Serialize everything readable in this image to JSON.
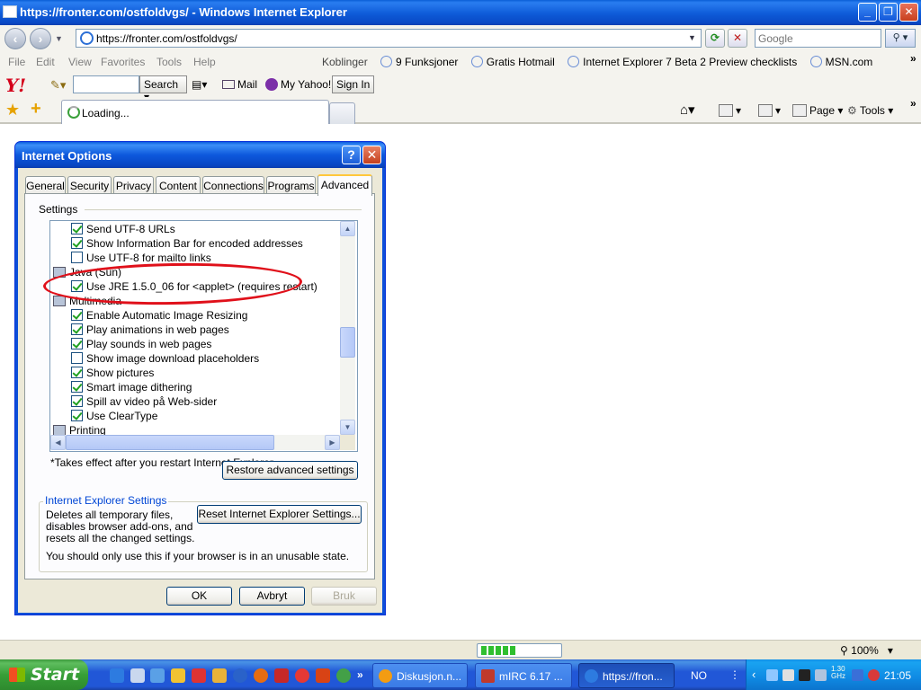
{
  "window": {
    "title": "https://fronter.com/ostfoldvgs/ - Windows Internet Explorer",
    "controls": {
      "minimize": "_",
      "maximize": "❐",
      "close": "✕"
    }
  },
  "address_bar": {
    "url": "https://fronter.com/ostfoldvgs/",
    "search_placeholder": "Google"
  },
  "menu": [
    "File",
    "Edit",
    "View",
    "Favorites",
    "Tools",
    "Help"
  ],
  "links_bar": {
    "label": "Koblinger",
    "links": [
      "9 Funksjoner",
      "Gratis Hotmail",
      "Internet Explorer 7 Beta 2 Preview checklists",
      "MSN.com"
    ]
  },
  "yahoo_toolbar": {
    "logo": "Y!",
    "search_button": "Search",
    "mail": "Mail",
    "my_yahoo": "My Yahoo!",
    "sign_in": "Sign In"
  },
  "tab_bar": {
    "active_tab": "Loading...",
    "page_menu": "Page",
    "tools_menu": "Tools"
  },
  "dialog": {
    "title": "Internet Options",
    "tabs": [
      "General",
      "Security",
      "Privacy",
      "Content",
      "Connections",
      "Programs",
      "Advanced"
    ],
    "active_tab": "Advanced",
    "settings_label": "Settings",
    "tree": [
      {
        "type": "check",
        "label": "Send UTF-8 URLs",
        "checked": true
      },
      {
        "type": "check",
        "label": "Show Information Bar for encoded addresses",
        "checked": true
      },
      {
        "type": "check",
        "label": "Use UTF-8 for mailto links",
        "checked": false
      },
      {
        "type": "category",
        "label": "Java (Sun)"
      },
      {
        "type": "check",
        "label": "Use JRE 1.5.0_06 for <applet> (requires restart)",
        "checked": true
      },
      {
        "type": "category",
        "label": "Multimedia"
      },
      {
        "type": "check",
        "label": "Enable Automatic Image Resizing",
        "checked": true
      },
      {
        "type": "check",
        "label": "Play animations in web pages",
        "checked": true
      },
      {
        "type": "check",
        "label": "Play sounds in web pages",
        "checked": true
      },
      {
        "type": "check",
        "label": "Show image download placeholders",
        "checked": false
      },
      {
        "type": "check",
        "label": "Show pictures",
        "checked": true
      },
      {
        "type": "check",
        "label": "Smart image dithering",
        "checked": true
      },
      {
        "type": "check",
        "label": "Spill av video på Web-sider",
        "checked": true
      },
      {
        "type": "check",
        "label": "Use ClearType",
        "checked": true
      },
      {
        "type": "category",
        "label": "Printing"
      }
    ],
    "restart_note": "*Takes effect after you restart Internet Explorer",
    "restore_button": "Restore advanced settings",
    "ie_settings": {
      "title": "Internet Explorer Settings",
      "description": "Deletes all temporary files, disables browser add-ons, and resets all the changed settings.",
      "reset_button": "Reset Internet Explorer Settings...",
      "warning": "You should only use this if your browser is in an unusable state."
    },
    "buttons": {
      "ok": "OK",
      "cancel": "Avbryt",
      "apply": "Bruk"
    },
    "highlight_color": "#e0101a"
  },
  "status_bar": {
    "progress_blocks": 5,
    "zoom": "100%"
  },
  "taskbar": {
    "start": "Start",
    "tasks": [
      {
        "label": "Diskusjon.n...",
        "active": false
      },
      {
        "label": "mIRC 6.17 ...",
        "active": false
      },
      {
        "label": "https://fron...",
        "active": true
      }
    ],
    "language": "NO",
    "cpu_top": "1.30",
    "cpu_bottom": "GHz",
    "clock": "21:05"
  }
}
